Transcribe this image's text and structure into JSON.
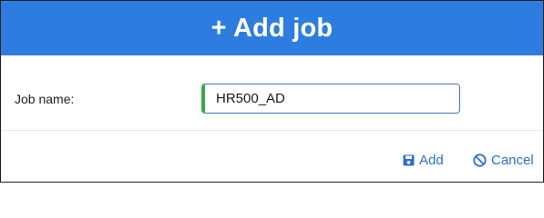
{
  "dialog": {
    "title": "+ Add job",
    "field_label": "Job name:",
    "job_name_value": "HR500_AD",
    "add_label": "Add",
    "cancel_label": "Cancel"
  },
  "colors": {
    "header": "#2d7de0",
    "input_border": "#3a73c4",
    "input_valid_bar": "#3ba84a",
    "link": "#2d6fcf"
  },
  "icons": {
    "add": "save-icon",
    "cancel": "ban-icon"
  }
}
